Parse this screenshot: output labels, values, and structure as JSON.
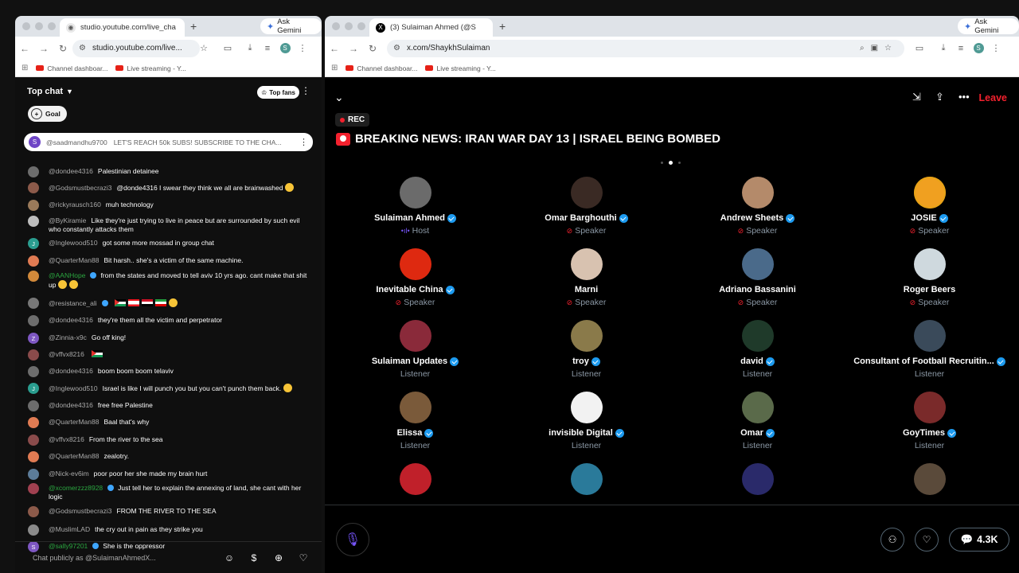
{
  "left_window": {
    "tab_title": "studio.youtube.com/live_cha",
    "gemini_label": "Ask Gemini",
    "url": "studio.youtube.com/live...",
    "profile_initial": "S",
    "bookmarks": [
      "Channel dashboar...",
      "Live streaming - Y..."
    ]
  },
  "right_window": {
    "tab_title": "(3) Sulaiman Ahmed (@S",
    "gemini_label": "Ask Gemini",
    "url": "x.com/ShaykhSulaiman",
    "profile_initial": "S",
    "bookmarks": [
      "Channel dashboar...",
      "Live streaming - Y..."
    ]
  },
  "chat": {
    "title": "Top chat",
    "top_fans": "Top fans",
    "goal": "Goal",
    "pinned": {
      "initial": "S",
      "author": "@saadmandhu9700",
      "text": "LET'S REACH 50k SUBS! SUBSCRIBE TO THE CHA..."
    },
    "messages": [
      {
        "author": "@dondee4316",
        "text": "Palestinian detainee",
        "color": "#6d6d6d",
        "initial": ""
      },
      {
        "author": "@Godsmustbecrazi3",
        "text": "@donde4316 I swear they think we all are brainwashed",
        "color": "#8c5a4a",
        "initial": ""
      },
      {
        "author": "@rickyrausch160",
        "text": "muh technology",
        "color": "#9a7a5a",
        "initial": ""
      },
      {
        "author": "@ByKiramie",
        "text": "Like they're just trying to live in peace but are surrounded by such evil who constantly attacks them",
        "color": "#bdbdbd",
        "initial": ""
      },
      {
        "author": "@Inglewood510",
        "text": "got some more mossad in group chat",
        "color": "#2a9d8f",
        "initial": "J"
      },
      {
        "author": "@QuarterMan88",
        "text": "Bit harsh.. she's a victim of the same machine.",
        "color": "#e07b53",
        "initial": ""
      },
      {
        "author": "@AANHope",
        "text": "from the states and moved to tell aviv 10 yrs ago. cant make that shit up",
        "color": "#d1893a",
        "initial": ""
      },
      {
        "author": "@resistance_ali",
        "text": "",
        "color": "#777777",
        "initial": ""
      },
      {
        "author": "@dondee4316",
        "text": "they're them all the victim and perpetrator",
        "color": "#6d6d6d",
        "initial": ""
      },
      {
        "author": "@Zinnia-x9c",
        "text": "Go off king!",
        "color": "#7e57c2",
        "initial": "Z"
      },
      {
        "author": "@vffvx8216",
        "text": "",
        "color": "#8a4b4b",
        "initial": ""
      },
      {
        "author": "@dondee4316",
        "text": "boom boom boom telaviv",
        "color": "#6d6d6d",
        "initial": ""
      },
      {
        "author": "@Inglewood510",
        "text": "Israel is like I will punch you but you can't punch them back.",
        "color": "#2a9d8f",
        "initial": "J"
      },
      {
        "author": "@dondee4316",
        "text": "free free Palestine",
        "color": "#6d6d6d",
        "initial": ""
      },
      {
        "author": "@QuarterMan88",
        "text": "Baal that's why",
        "color": "#e07b53",
        "initial": ""
      },
      {
        "author": "@vffvx8216",
        "text": "From the river to the sea",
        "color": "#8a4b4b",
        "initial": ""
      },
      {
        "author": "@QuarterMan88",
        "text": "zealotry.",
        "color": "#e07b53",
        "initial": ""
      },
      {
        "author": "@Nick-ev6im",
        "text": "poor poor her she made my brain hurt",
        "color": "#5c7c99",
        "initial": ""
      },
      {
        "author": "@xcomerzzz8928",
        "text": "Just tell her to explain the annexing of land, she cant with her logic",
        "color": "#a04050",
        "initial": ""
      },
      {
        "author": "@Godsmustbecrazi3",
        "text": "FROM THE RIVER TO THE SEA",
        "color": "#8c5a4a",
        "initial": ""
      },
      {
        "author": "@MuslimLAD",
        "text": "the cry out in pain as they strike you",
        "color": "#8a8a8a",
        "initial": ""
      },
      {
        "author": "@sally97201",
        "text": "She is the oppressor",
        "color": "#7e57c2",
        "initial": "S"
      }
    ],
    "input_placeholder": "Chat publicly as @SulaimanAhmedX..."
  },
  "space": {
    "leave": "Leave",
    "rec": "REC",
    "title": "BREAKING NEWS: IRAN WAR DAY 13 | ISRAEL BEING BOMBED",
    "participants": [
      {
        "name": "Sulaiman Ahmed",
        "role": "Host",
        "verified": true,
        "color": "#6b6b6b"
      },
      {
        "name": "Omar Barghouthi",
        "role": "Speaker",
        "verified": true,
        "color": "#3a2a24"
      },
      {
        "name": "Andrew Sheets",
        "role": "Speaker",
        "verified": true,
        "color": "#b48a6a"
      },
      {
        "name": "JOSIE",
        "role": "Speaker",
        "verified": true,
        "color": "#f0a020"
      },
      {
        "name": "Inevitable China",
        "role": "Speaker",
        "verified": true,
        "color": "#de2910"
      },
      {
        "name": "Marni",
        "role": "Speaker",
        "verified": false,
        "color": "#d8c2b0"
      },
      {
        "name": "Adriano Bassanini",
        "role": "Speaker",
        "verified": false,
        "color": "#4a6a8a"
      },
      {
        "name": "Roger Beers",
        "role": "Speaker",
        "verified": false,
        "color": "#cfd9de"
      },
      {
        "name": "Sulaiman Updates",
        "role": "Listener",
        "verified": true,
        "color": "#8a2a3a"
      },
      {
        "name": "troy",
        "role": "Listener",
        "verified": true,
        "color": "#8a7a4a"
      },
      {
        "name": "david",
        "role": "Listener",
        "verified": true,
        "color": "#1f3a2a"
      },
      {
        "name": "Consultant of Football Recruitin...",
        "role": "Listener",
        "verified": true,
        "color": "#3a4a5a"
      },
      {
        "name": "Elissa",
        "role": "Listener",
        "verified": true,
        "color": "#7a5a3a"
      },
      {
        "name": "invisible Digital",
        "role": "Listener",
        "verified": true,
        "color": "#f2f2f2"
      },
      {
        "name": "Omar",
        "role": "Listener",
        "verified": true,
        "color": "#5a6a4a"
      },
      {
        "name": "GoyTimes",
        "role": "Listener",
        "verified": true,
        "color": "#7a2a2a"
      },
      {
        "name": "",
        "role": "",
        "verified": false,
        "color": "#c0202a"
      },
      {
        "name": "",
        "role": "",
        "verified": false,
        "color": "#2a7a9a"
      },
      {
        "name": "",
        "role": "",
        "verified": false,
        "color": "#2a2a6a"
      },
      {
        "name": "",
        "role": "",
        "verified": false,
        "color": "#5a4a3a"
      }
    ],
    "comment_count": "4.3K"
  }
}
